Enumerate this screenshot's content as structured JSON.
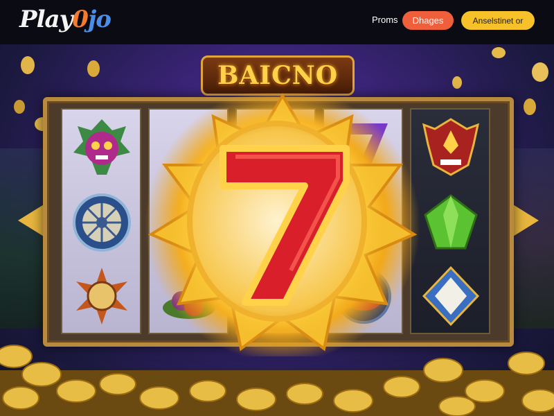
{
  "header": {
    "logo": {
      "part1": "Play",
      "part2": "0",
      "part3": "jo"
    },
    "nav_link": "Proms",
    "button_primary": "Dhages",
    "button_secondary": "Anselstinet or"
  },
  "hero": {
    "title": "BAICNO",
    "center_symbol": "7"
  },
  "colors": {
    "header_bg": "#0a0b13",
    "button_orange": "#ef5f3b",
    "button_yellow": "#f7c129",
    "gold": "#e8b63e",
    "purple_bg": "#3a2477"
  }
}
